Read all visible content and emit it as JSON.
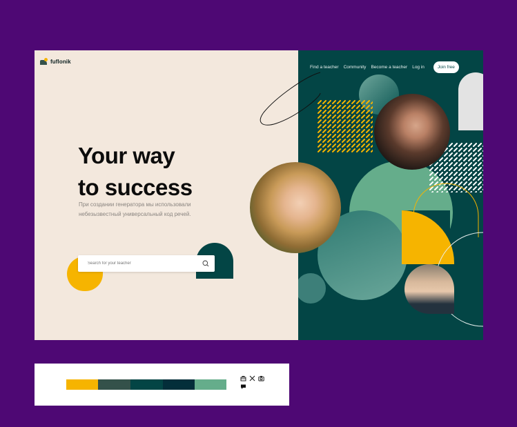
{
  "brand": {
    "name": "fuflonik"
  },
  "nav": {
    "items": [
      "Find a teacher",
      "Community",
      "Become a teacher",
      "Log in"
    ],
    "cta": "Join free"
  },
  "hero": {
    "title_line1": "Your way",
    "title_line2": "to success",
    "subtitle": "При создании генератора мы использовали небезызвестный универсальный код речей."
  },
  "search": {
    "placeholder": "Search for your teacher"
  },
  "palette": {
    "colors": [
      "#f6b400",
      "#34514a",
      "#034545",
      "#032e3a",
      "#65ad8b"
    ]
  },
  "colors": {
    "background": "#4e0874",
    "hero_left": "#f3e8dd",
    "hero_right": "#034545",
    "accent_yellow": "#f6b400",
    "accent_mint": "#65ad8b"
  },
  "icons": [
    "store-icon",
    "x-icon",
    "camera-icon",
    "chat-icon"
  ]
}
